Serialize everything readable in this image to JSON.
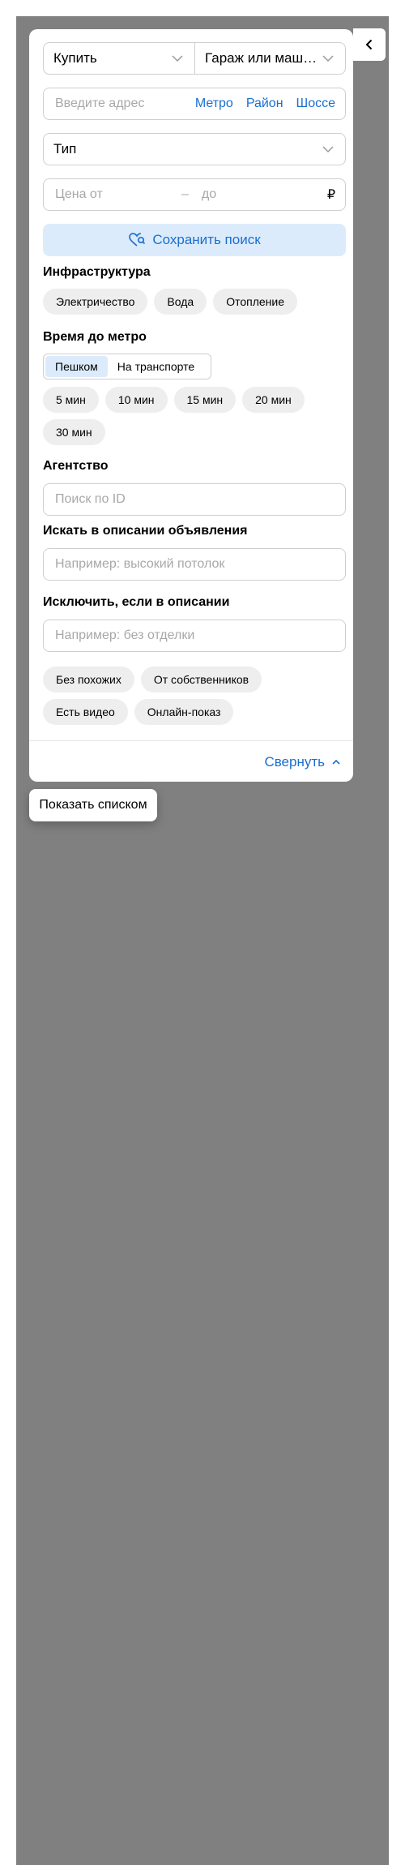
{
  "filters": {
    "deal_type": "Купить",
    "property_type": "Гараж или машиноместо",
    "address_placeholder": "Введите адрес",
    "address_links": [
      "Метро",
      "Район",
      "Шоссе"
    ],
    "type_select": "Тип",
    "price_from_placeholder": "Цена от",
    "price_dash": "–",
    "price_to_placeholder": "до",
    "currency": "₽",
    "save_search": "Сохранить поиск"
  },
  "infrastructure": {
    "title": "Инфраструктура",
    "options": [
      "Электричество",
      "Вода",
      "Отопление"
    ]
  },
  "metro_time": {
    "title": "Время до метро",
    "modes": [
      "Пешком",
      "На транспорте"
    ],
    "active_mode": "Пешком",
    "options": [
      "5 мин",
      "10 мин",
      "15 мин",
      "20 мин",
      "30 мин"
    ]
  },
  "agency": {
    "title": "Агентство",
    "placeholder": "Поиск по ID"
  },
  "description_include": {
    "title": "Искать в описании объявления",
    "placeholder": "Например: высокий потолок"
  },
  "description_exclude": {
    "title": "Исключить, если в описании",
    "placeholder": "Например: без отделки"
  },
  "extra_options": [
    "Без похожих",
    "От собственников",
    "Есть видео",
    "Онлайн-показ"
  ],
  "collapse_label": "Свернуть",
  "show_list_label": "Показать списком",
  "colors": {
    "accent": "#1a6fd0",
    "accent_bg": "#dcebfb",
    "chip_bg": "#eeeeee",
    "map_bg": "#808080"
  }
}
